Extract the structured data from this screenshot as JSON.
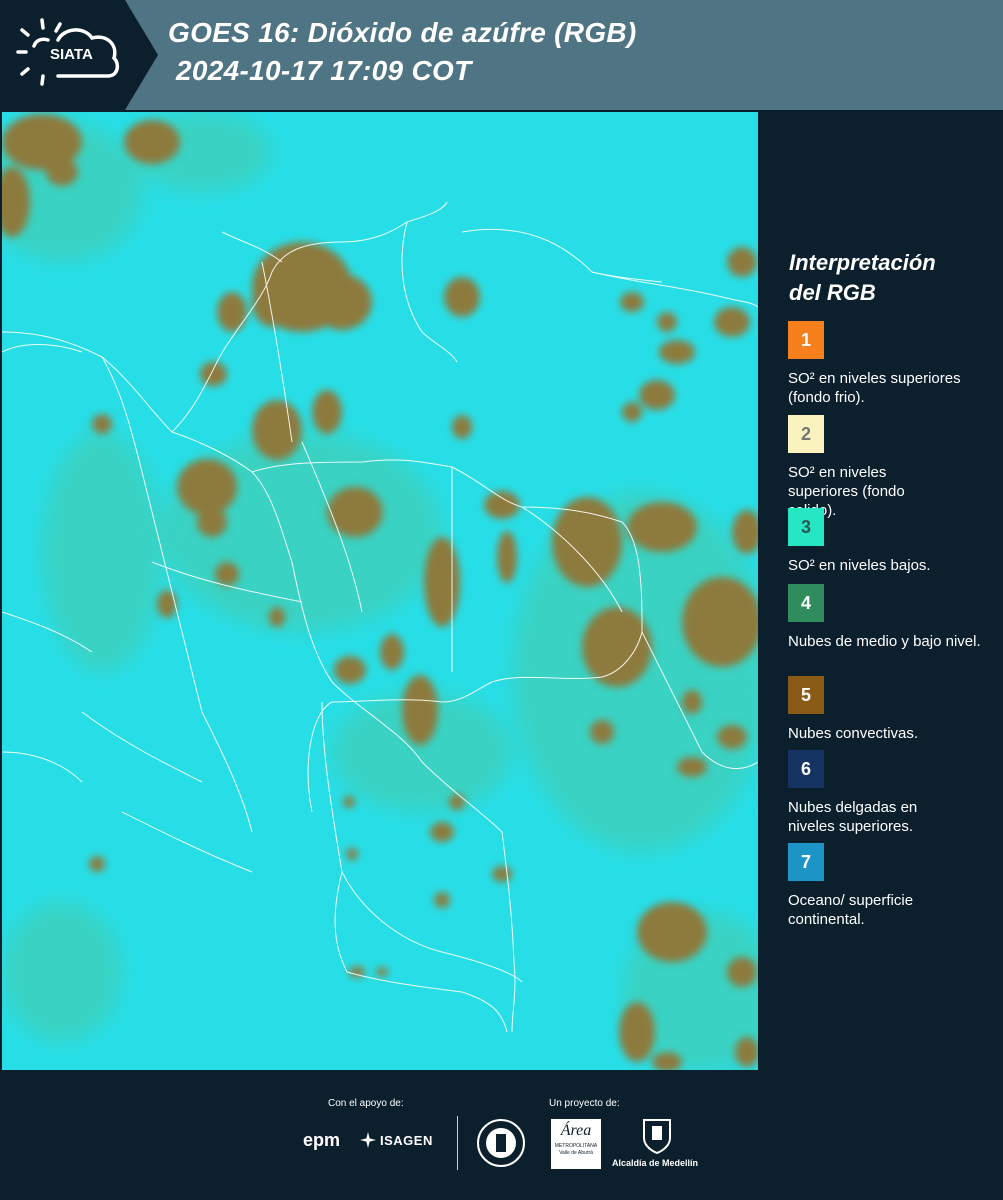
{
  "header": {
    "logo_text": "SIATA",
    "title_line1": "GOES 16: Dióxido de azúfre (RGB)",
    "title_line2": "2024-10-17 17:09 COT"
  },
  "legend": {
    "title_line1": "Interpretación",
    "title_line2": "del RGB",
    "items": [
      {
        "num": "1",
        "label": "SO² en niveles superiores (fondo frio).",
        "color": "#f6811c",
        "text_color": "#ffffff"
      },
      {
        "num": "2",
        "label": "SO² en niveles superiores (fondo calido).",
        "color": "#fbf3bd",
        "text_color": "#777777"
      },
      {
        "num": "3",
        "label": "SO² en niveles bajos.",
        "color": "#27e6c3",
        "text_color": "#2a5a55"
      },
      {
        "num": "4",
        "label": "Nubes de medio y bajo nivel.",
        "color": "#2f8c5c",
        "text_color": "#ffffff"
      },
      {
        "num": "5",
        "label": "Nubes convectivas.",
        "color": "#8a5b17",
        "text_color": "#ffffff"
      },
      {
        "num": "6",
        "label": "Nubes delgadas en niveles superiores.",
        "color": "#153363",
        "text_color": "#ffffff"
      },
      {
        "num": "7",
        "label": "Oceano/ superficie continental.",
        "color": "#1c95c6",
        "text_color": "#ffffff"
      }
    ]
  },
  "map": {
    "background_color": "#26dde6",
    "cloud_color": "#8d7a3c",
    "border_color": "#ffffff"
  },
  "footer": {
    "support_label": "Con el apoyo de:",
    "project_label": "Un proyecto de:",
    "epm": "epm",
    "isagen": "ISAGEN",
    "area_line1": "Área",
    "area_line2": "METROPOLITANA",
    "area_line3": "Valle de Aburrá",
    "alcaldia": "Alcaldía de Medellín"
  }
}
